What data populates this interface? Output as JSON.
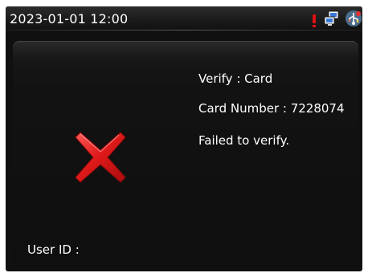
{
  "status_bar": {
    "datetime": "2023-01-01 12:00",
    "icons": [
      "alert-icon",
      "network-icon",
      "usb-icon"
    ]
  },
  "verification": {
    "method_line": "Verify : Card",
    "card_number_line": "Card Number : 7228074",
    "result_line": "Failed to verify.",
    "result_icon": "red-x-icon",
    "user_id_label": "User ID :"
  },
  "colors": {
    "fail": "#d81a1a",
    "alert": "#e01010",
    "text": "#ffffff",
    "background": "#101010"
  }
}
